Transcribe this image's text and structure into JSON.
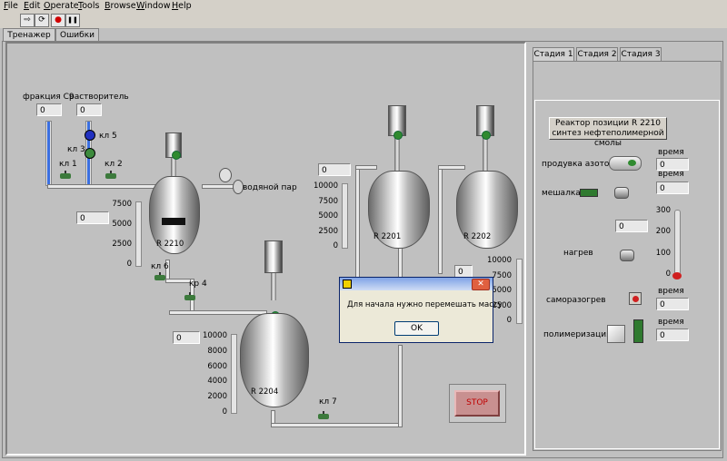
{
  "menu": [
    "File",
    "Edit",
    "Operate",
    "Tools",
    "Browse",
    "Window",
    "Help"
  ],
  "toolbar": {
    "run": "⇨",
    "run_cont": "⟳",
    "abort": "●",
    "pause": "❚❚"
  },
  "tabs": [
    "Тренажер",
    "Ошибки"
  ],
  "stage_tabs": [
    "Стадия 1",
    "Стадия 2",
    "Стадия 3"
  ],
  "feeds": {
    "c9_label": "фракция С9",
    "c9_value": "0",
    "solvent_label": "растворитель",
    "solvent_value": "0"
  },
  "valves": {
    "kl1": "кл 1",
    "kl2": "кл 2",
    "kl3": "кл 3",
    "kl5": "кл 5",
    "kl6": "кл 6",
    "kr4": "кр 4",
    "kl7": "кл 7"
  },
  "steam_label": "водяной пар",
  "reactors": {
    "r2210": {
      "name": "R 2210",
      "level_value": "0",
      "ticks": [
        "7500",
        "5000",
        "2500",
        "0"
      ],
      "level": 0
    },
    "r2201": {
      "name": "R 2201",
      "level_value": "0",
      "ticks": [
        "10000",
        "7500",
        "5000",
        "2500",
        "0"
      ],
      "level": 0
    },
    "r2202": {
      "name": "R 2202",
      "level_value": "0",
      "ticks": [
        "10000",
        "7500",
        "5000",
        "2500",
        "0"
      ],
      "level": 0
    },
    "r2204": {
      "name": "R 2204",
      "level_value": "0",
      "ticks": [
        "10000",
        "8000",
        "6000",
        "4000",
        "2000",
        "0"
      ],
      "level": 0
    }
  },
  "stage1": {
    "title_line1": "Реактор позиции R 2210",
    "title_line2": "синтез нефтеполимерной смолы",
    "nitrogen_label": "продувка азотом",
    "time_label": "время",
    "nitrogen_time": "0",
    "mixer_label": "мешалка",
    "mixer_time": "0",
    "heat_value": "0",
    "heat_label": "нагрев",
    "heat_ticks": [
      "300",
      "200",
      "100",
      "0"
    ],
    "heat_level": 0,
    "selfheat_label": "саморазогрев",
    "selfheat_time": "0",
    "polymer_label": "полимеризация",
    "polymer_time": "0"
  },
  "dialog": {
    "message": "Для начала нужно перемешать массу",
    "ok": "OK",
    "close": "✕"
  },
  "stop_label": "STOP",
  "colors": {
    "accent_blue": "#3b6fe0",
    "indicator_green": "#2f8a2f",
    "stop_red": "#c00000"
  }
}
